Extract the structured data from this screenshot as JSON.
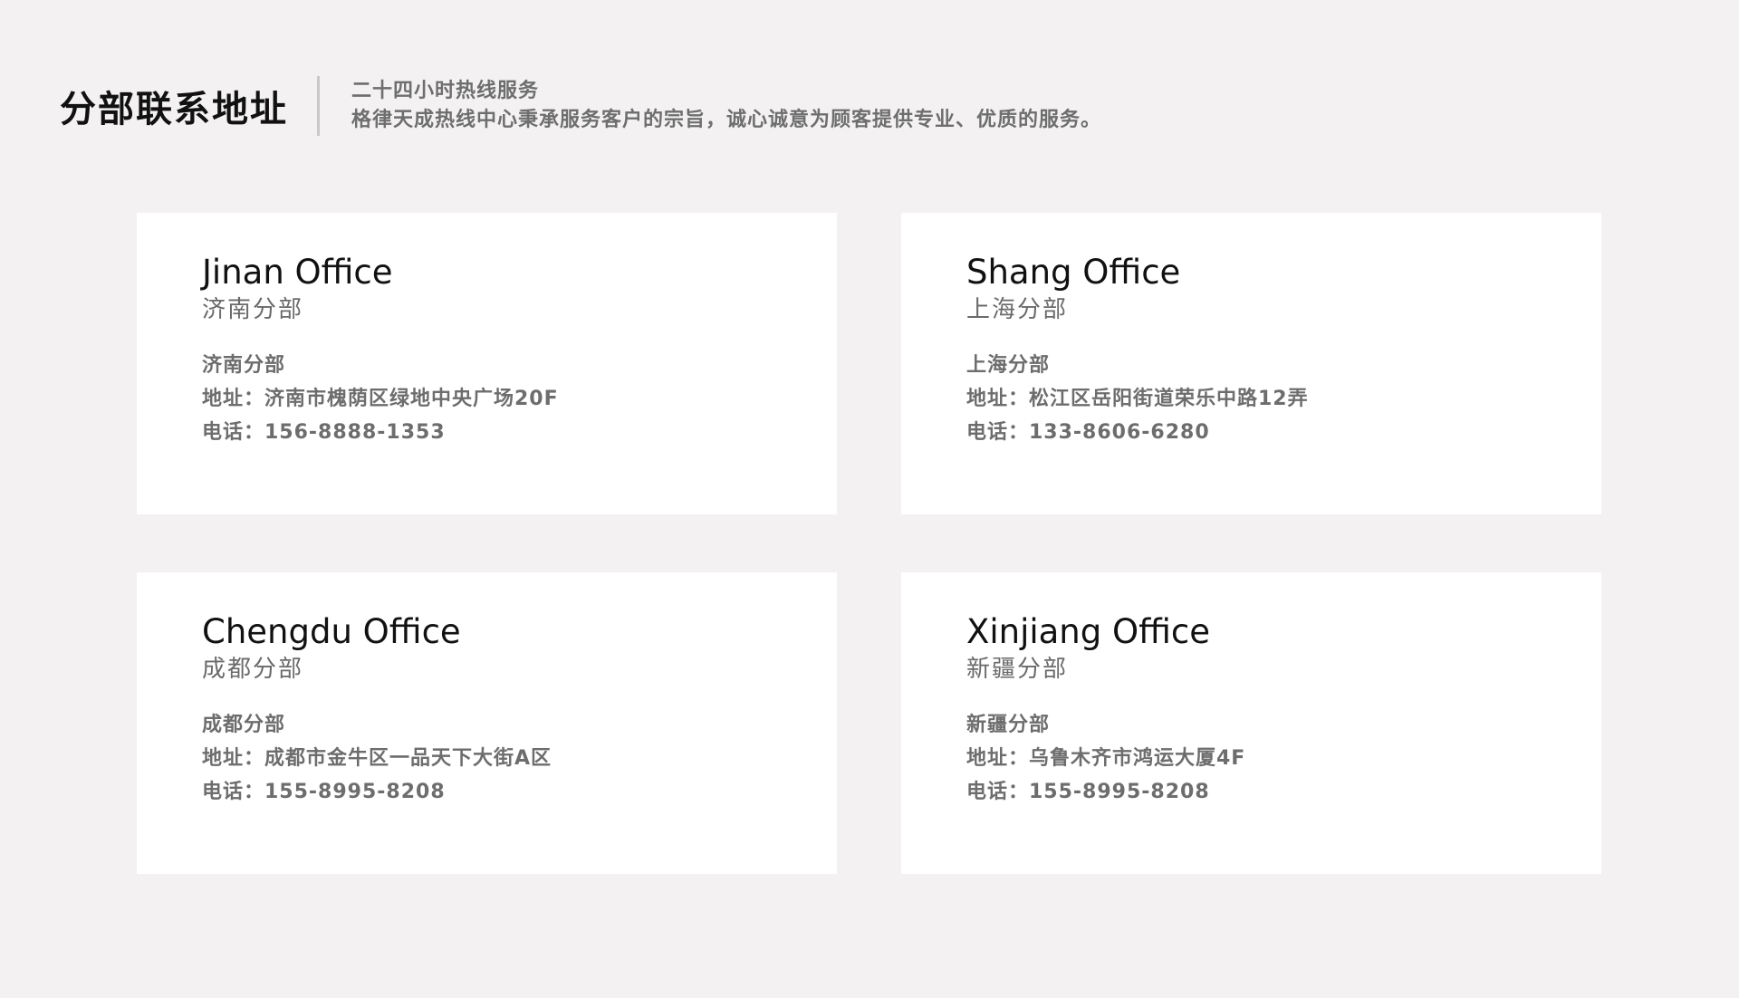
{
  "header": {
    "title": "分部联系地址",
    "line1": "二十四小时热线服务",
    "line2": "格律天成热线中心秉承服务客户的宗旨，诚心诚意为顾客提供专业、优质的服务。"
  },
  "offices": [
    {
      "title": "Jinan Office",
      "subtitle": "济南分部",
      "name": "济南分部",
      "address": "地址：济南市槐荫区绿地中央广场20F",
      "phone": "电话：156-8888-1353"
    },
    {
      "title": "Shang Office",
      "subtitle": "上海分部",
      "name": "上海分部",
      "address": "地址：松江区岳阳街道荣乐中路12弄",
      "phone": "电话：133-8606-6280"
    },
    {
      "title": "Chengdu Office",
      "subtitle": "成都分部",
      "name": "成都分部",
      "address": "地址：成都市金牛区一品天下大街A区",
      "phone": "电话：155-8995-8208"
    },
    {
      "title": "Xinjiang Office",
      "subtitle": "新疆分部",
      "name": "新疆分部",
      "address": "地址：乌鲁木齐市鸿运大厦4F",
      "phone": "电话：155-8995-8208"
    }
  ]
}
